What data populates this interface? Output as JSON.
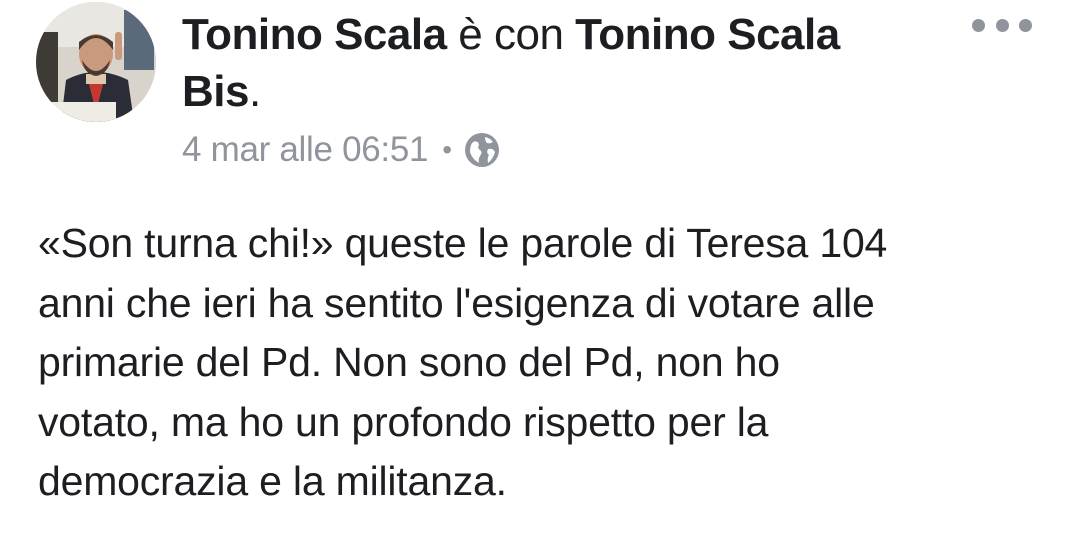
{
  "post": {
    "author": "Tonino Scala",
    "with_text": " è con ",
    "tagged_line1": "Tonino Scala",
    "tagged_line2": "Bis",
    "period": ".",
    "timestamp": "4 mar alle 06:51",
    "separator": "•",
    "privacy_icon": "globe-icon",
    "more_icon": "ellipsis-icon",
    "body_lines": [
      "«Son turna chi!» queste le parole di Teresa 104",
      "anni che ieri ha sentito l'esigenza di votare alle",
      "primarie del Pd. Non sono del Pd, non ho",
      "votato, ma ho un profondo rispetto per la",
      "democrazia e la militanza."
    ]
  },
  "colors": {
    "text": "#1c1e21",
    "meta": "#90949c"
  }
}
